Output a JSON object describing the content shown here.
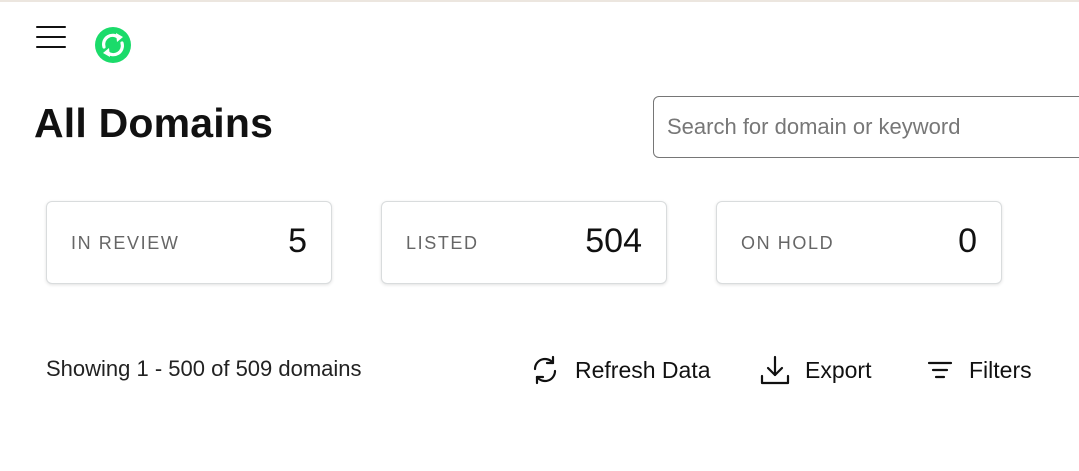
{
  "header": {
    "menu_icon": "hamburger-menu-icon",
    "logo_icon": "refresh-arrows-logo",
    "logo_color": "#1bdb6a"
  },
  "page": {
    "title": "All Domains"
  },
  "search": {
    "placeholder": "Search for domain or keyword",
    "value": ""
  },
  "stats": [
    {
      "label": "IN REVIEW",
      "value": "5"
    },
    {
      "label": "LISTED",
      "value": "504"
    },
    {
      "label": "ON HOLD",
      "value": "0"
    }
  ],
  "toolbar": {
    "showing_text": "Showing 1 - 500 of 509 domains",
    "refresh_label": "Refresh Data",
    "refresh_icon": "refresh-icon",
    "export_label": "Export",
    "export_icon": "download-icon",
    "filters_label": "Filters",
    "filters_icon": "filter-lines-icon"
  }
}
